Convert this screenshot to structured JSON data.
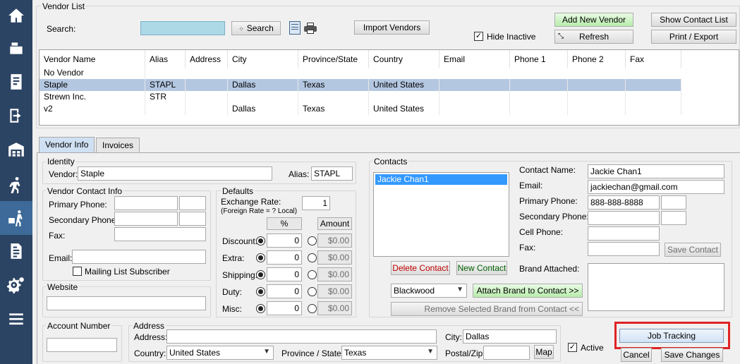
{
  "sidebar": {
    "items": [
      {
        "icon": "home-icon"
      },
      {
        "icon": "cash-register-icon"
      },
      {
        "icon": "receipt-icon"
      },
      {
        "icon": "exit-icon"
      },
      {
        "icon": "warehouse-icon"
      },
      {
        "icon": "person-walking-icon"
      },
      {
        "icon": "vendor-delivery-icon",
        "active": true
      },
      {
        "icon": "report-icon"
      },
      {
        "icon": "settings-icon"
      },
      {
        "icon": "menu-icon"
      }
    ]
  },
  "vendor_list": {
    "title": "Vendor List",
    "search_label": "Search:",
    "search_value": "",
    "search_button": "Search",
    "import_button": "Import Vendors",
    "add_new_button": "Add New Vendor",
    "show_contact_button": "Show Contact List",
    "hide_inactive_label": "Hide Inactive",
    "hide_inactive_checked": true,
    "refresh_button": "Refresh",
    "print_button": "Print / Export",
    "columns": [
      "Vendor Name",
      "Alias",
      "Address",
      "City",
      "Province/State",
      "Country",
      "Email",
      "Phone 1",
      "Phone 2",
      "Fax"
    ],
    "rows": [
      {
        "name": "No Vendor",
        "alias": "",
        "address": "",
        "city": "",
        "province": "",
        "country": "",
        "email": "",
        "phone1": "",
        "phone2": "",
        "fax": ""
      },
      {
        "name": "Staple",
        "alias": "STAPL",
        "address": "",
        "city": "Dallas",
        "province": "Texas",
        "country": "United States",
        "email": "",
        "phone1": "",
        "phone2": "",
        "fax": "",
        "selected": true
      },
      {
        "name": "Strewn Inc.",
        "alias": "STR",
        "address": "",
        "city": "",
        "province": "",
        "country": "",
        "email": "",
        "phone1": "",
        "phone2": "",
        "fax": ""
      },
      {
        "name": "v2",
        "alias": "",
        "address": "",
        "city": "Dallas",
        "province": "Texas",
        "country": "United States",
        "email": "",
        "phone1": "",
        "phone2": "",
        "fax": ""
      }
    ]
  },
  "tabs": [
    "Vendor Info",
    "Invoices"
  ],
  "identity": {
    "title": "Identity",
    "vendor_label": "Vendor:",
    "vendor_value": "Staple",
    "alias_label": "Alias:",
    "alias_value": "STAPL"
  },
  "contact_info": {
    "title": "Vendor Contact Info",
    "primary_label": "Primary Phone:",
    "secondary_label": "Secondary Phone:",
    "fax_label": "Fax:",
    "email_label": "Email:",
    "mailing_label": "Mailing List Subscriber"
  },
  "website": {
    "title": "Website",
    "value": ""
  },
  "defaults": {
    "title": "Defaults",
    "exchange_label": "Exchange Rate:",
    "exchange_value": "1",
    "exchange_note": "(Foreign  Rate = ? Local)",
    "pct_header": "%",
    "amount_header": "Amount",
    "rows": [
      {
        "label": "Discount:",
        "pct": "0",
        "amount": "$0.00"
      },
      {
        "label": "Extra:",
        "pct": "0",
        "amount": "$0.00"
      },
      {
        "label": "Shipping:",
        "pct": "0",
        "amount": "$0.00"
      },
      {
        "label": "Duty:",
        "pct": "0",
        "amount": "$0.00"
      },
      {
        "label": "Misc:",
        "pct": "0",
        "amount": "$0.00"
      }
    ]
  },
  "contacts": {
    "title": "Contacts",
    "list": [
      "Jackie Chan1"
    ],
    "delete_button": "Delete Contact",
    "new_button": "New Contact",
    "brand_value": "Blackwood",
    "attach_button": "Attach Brand to Contact >>",
    "remove_button": "Remove Selected Brand from Contact <<"
  },
  "contact_detail": {
    "name_label": "Contact Name:",
    "name_value": "Jackie Chan1",
    "email_label": "Email:",
    "email_value": "jackiechan@gmail.com",
    "primary_label": "Primary Phone:",
    "primary_value": "888-888-8888",
    "secondary_label": "Secondary Phone:",
    "cell_label": "Cell Phone:",
    "fax_label": "Fax:",
    "save_contact_button": "Save Contact",
    "brand_attached_label": "Brand Attached:"
  },
  "account": {
    "title": "Account Number",
    "value": ""
  },
  "address": {
    "title": "Address",
    "address_label": "Address:",
    "address_value": "",
    "country_label": "Country:",
    "country_value": "United States",
    "province_label": "Province / State:",
    "province_value": "Texas",
    "city_label": "City:",
    "city_value": "Dallas",
    "postal_label": "Postal/Zip:",
    "postal_value": "",
    "map_button": "Map"
  },
  "active": {
    "label": "Active",
    "checked": true
  },
  "job_tracking_button": "Job Tracking",
  "cancel_button": "Cancel",
  "save_changes_button": "Save Changes",
  "colors": {
    "sidebar": "#2c4463",
    "sidebar_active": "#3d6a98",
    "selection": "#b4c7e1",
    "highlight": "#e02323"
  }
}
